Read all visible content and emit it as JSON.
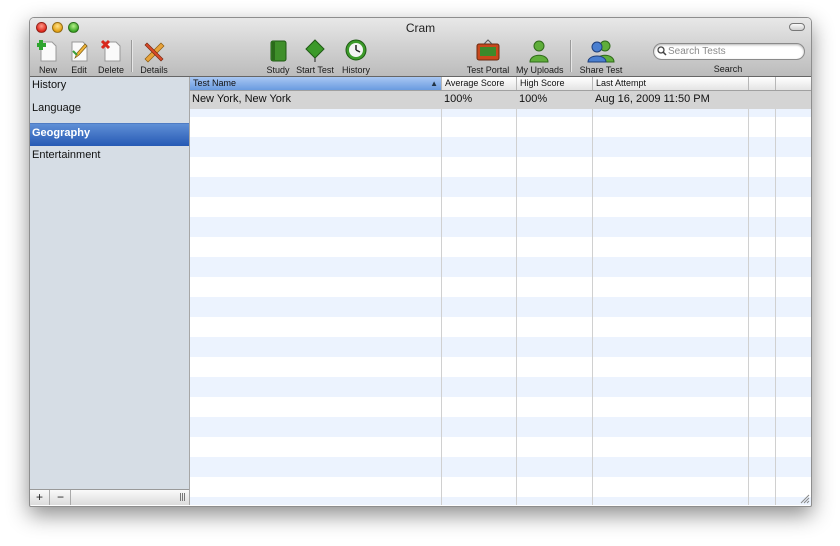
{
  "window": {
    "title": "Cram"
  },
  "toolbar": {
    "new_label": "New",
    "edit_label": "Edit",
    "delete_label": "Delete",
    "details_label": "Details",
    "study_label": "Study",
    "start_test_label": "Start Test",
    "history_label": "History",
    "test_portal_label": "Test Portal",
    "my_uploads_label": "My Uploads",
    "share_test_label": "Share Test",
    "search_placeholder": "Search Tests",
    "search_label": "Search"
  },
  "sidebar": {
    "items": [
      {
        "label": "History",
        "selected": false
      },
      {
        "label": "Language",
        "selected": false
      },
      {
        "label": "Geography",
        "selected": true
      },
      {
        "label": "Entertainment",
        "selected": false
      }
    ],
    "add_label": "+",
    "remove_label": "−"
  },
  "table": {
    "columns": [
      "Test Name",
      "Average Score",
      "High Score",
      "Last Attempt"
    ],
    "sort_indicator": "▲",
    "rows": [
      {
        "test_name": "New York, New York",
        "average_score": "100%",
        "high_score": "100%",
        "last_attempt": "Aug 16, 2009 11:50 PM"
      }
    ]
  },
  "colors": {
    "selection": "#2659b4",
    "alt_row": "#ecf3fe",
    "sidebar_bg": "#d6dde5"
  }
}
